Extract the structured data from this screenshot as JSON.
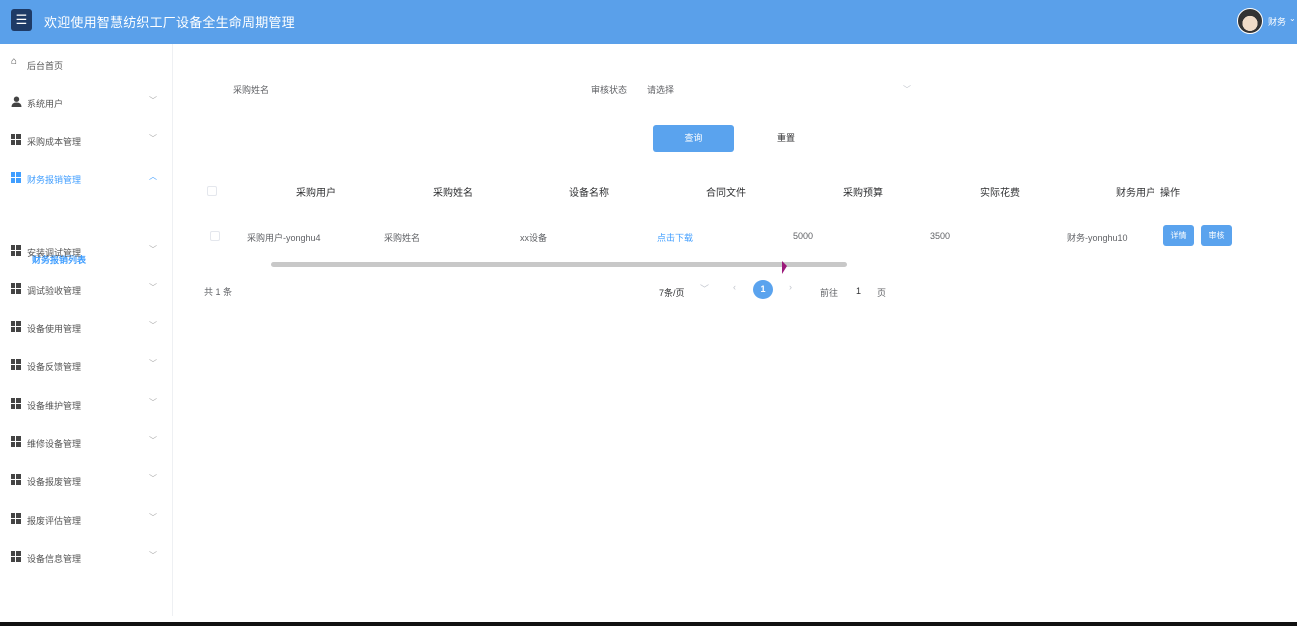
{
  "header": {
    "title": "欢迎使用智慧纺织工厂设备全生命周期管理",
    "menu_icon": "hamburger-icon",
    "user": "财务"
  },
  "sidebar": {
    "items": [
      {
        "label": "后台首页",
        "icon": "home-icon"
      },
      {
        "label": "系统用户",
        "icon": "user-icon"
      },
      {
        "label": "采购成本管理",
        "icon": "grid-icon"
      },
      {
        "label": "财务报销管理",
        "icon": "grid-icon"
      },
      {
        "label": "安装调试管理",
        "icon": "grid-icon"
      },
      {
        "label": "调试验收管理",
        "icon": "grid-icon"
      },
      {
        "label": "设备使用管理",
        "icon": "grid-icon"
      },
      {
        "label": "设备反馈管理",
        "icon": "grid-icon"
      },
      {
        "label": "设备维护管理",
        "icon": "grid-icon"
      },
      {
        "label": "维修设备管理",
        "icon": "grid-icon"
      },
      {
        "label": "设备报废管理",
        "icon": "grid-icon"
      },
      {
        "label": "报废评估管理",
        "icon": "grid-icon"
      },
      {
        "label": "设备信息管理",
        "icon": "grid-icon"
      }
    ],
    "active_sub": "财务报销列表"
  },
  "filters": {
    "purchase_name_label": "采购姓名",
    "status_label": "审核状态",
    "status_placeholder": "请选择"
  },
  "buttons": {
    "query": "查询",
    "reset": "重置"
  },
  "table": {
    "headers": [
      "采购用户",
      "采购姓名",
      "设备名称",
      "合同文件",
      "采购预算",
      "实际花费",
      "财务用户",
      "操作"
    ],
    "rows": [
      {
        "purchase_user": "采购用户-yonghu4",
        "purchase_name": "采购姓名",
        "device_name": "xx设备",
        "contract": "点击下载",
        "budget": "5000",
        "actual": "3500",
        "finance_user": "财务-yonghu10",
        "detail_btn": "详情",
        "audit_btn": "审核"
      }
    ]
  },
  "pagination": {
    "total": "共 1 条",
    "page_size": "7条/页",
    "current_page": "1",
    "goto_label": "前往",
    "goto_value": "1",
    "page_suffix": "页"
  }
}
